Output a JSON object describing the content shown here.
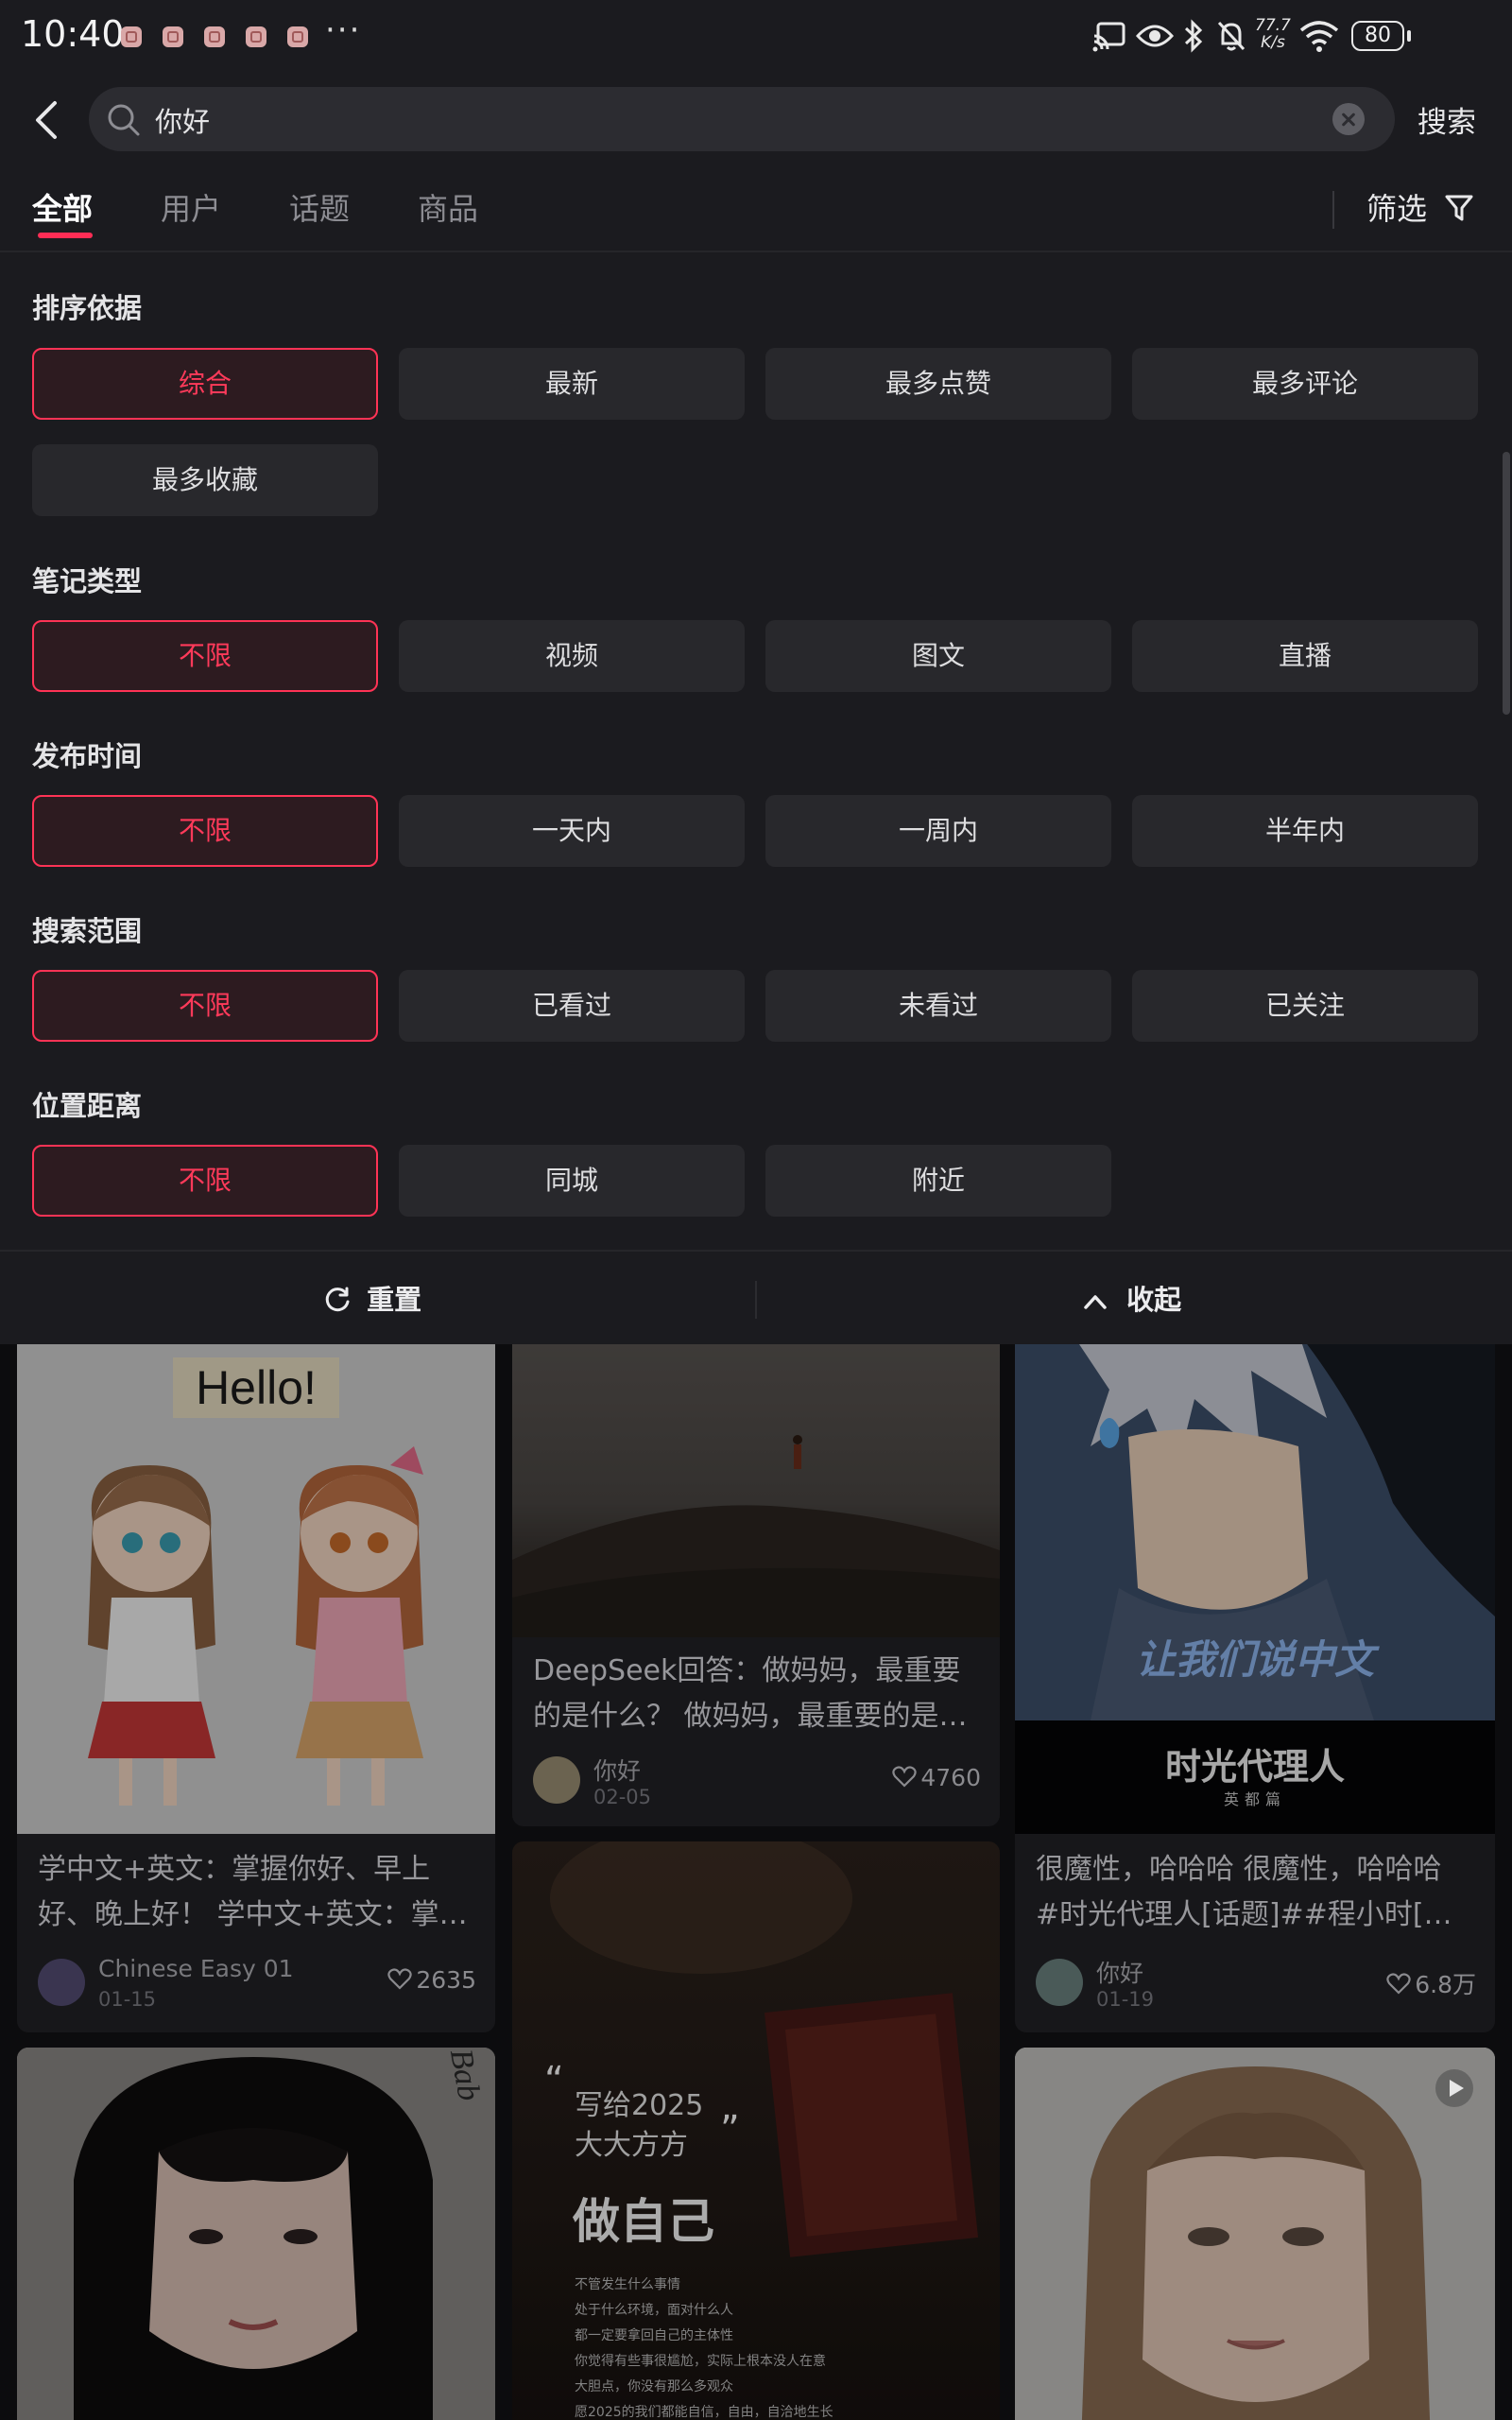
{
  "status_bar": {
    "time": "10:40",
    "more": "···",
    "net_speed_value": "77.7",
    "net_speed_unit": "K/s",
    "battery": "80"
  },
  "header": {
    "query": "你好",
    "search_label": "搜索"
  },
  "tabs": [
    {
      "label": "全部",
      "active": true
    },
    {
      "label": "用户",
      "active": false
    },
    {
      "label": "话题",
      "active": false
    },
    {
      "label": "商品",
      "active": false
    }
  ],
  "filter_label": "筛选",
  "filters": {
    "sort": {
      "title": "排序依据",
      "options": [
        "综合",
        "最新",
        "最多点赞",
        "最多评论",
        "最多收藏"
      ],
      "selected": "综合"
    },
    "note_type": {
      "title": "笔记类型",
      "options": [
        "不限",
        "视频",
        "图文",
        "直播"
      ],
      "selected": "不限"
    },
    "publish_time": {
      "title": "发布时间",
      "options": [
        "不限",
        "一天内",
        "一周内",
        "半年内"
      ],
      "selected": "不限"
    },
    "search_scope": {
      "title": "搜索范围",
      "options": [
        "不限",
        "已看过",
        "未看过",
        "已关注"
      ],
      "selected": "不限"
    },
    "distance": {
      "title": "位置距离",
      "options": [
        "不限",
        "同城",
        "附近"
      ],
      "selected": "不限"
    }
  },
  "footer": {
    "reset_label": "重置",
    "collapse_label": "收起"
  },
  "feed": [
    {
      "title_line1": "学中文+英文：掌握你好、早上",
      "title_line2": "好、晚上好！ 学中文+英文：掌…",
      "author": "Chinese Easy 01",
      "date": "01-15",
      "likes": "2635",
      "image_text": "Hello!"
    },
    {
      "title_line1": "DeepSeek回答：做妈妈，最重要",
      "title_line2": "的是什么？ 做妈妈，最重要的是…",
      "author": "你好",
      "date": "02-05",
      "likes": "4760"
    },
    {
      "title_line1": "很魔性，哈哈哈 很魔性，哈哈哈",
      "title_line2": "#时光代理人[话题]##程小时[…",
      "author": "你好",
      "date": "01-19",
      "likes": "6.8万",
      "image_caption": "让我们说中文",
      "image_brand": "时光代理人",
      "image_brand_sub": "英都篇"
    },
    {
      "image_text": "Bab"
    },
    {
      "image_quote1": "写给2025",
      "image_quote2": "大大方方",
      "image_headline": "做自己",
      "image_body": [
        "不管发生什么事情",
        "处于什么环境，面对什么人",
        "都一定要拿回自己的主体性",
        "你觉得有些事很尴尬，实际上根本没人在意",
        "大胆点，你没有那么多观众",
        "愿2025的我们都能自信，自由，自洽地生长"
      ]
    },
    {
      "is_video": true
    }
  ]
}
